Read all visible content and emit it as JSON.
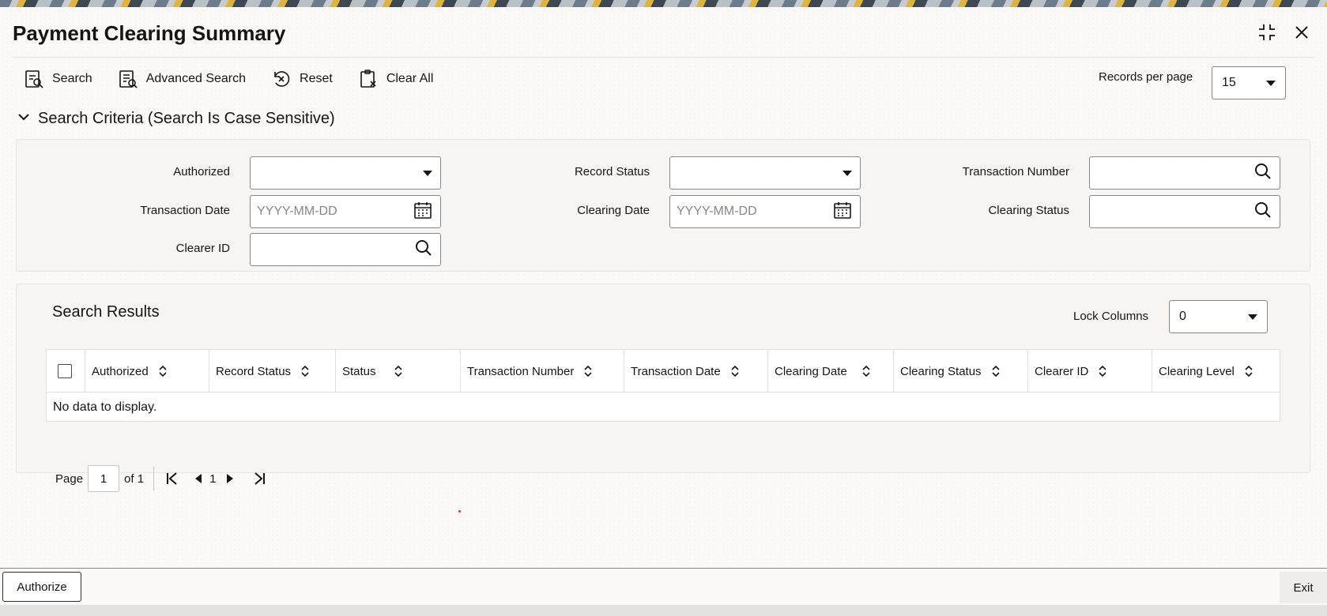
{
  "window": {
    "title": "Payment Clearing Summary",
    "icons": [
      "collapse-icon",
      "close-icon"
    ]
  },
  "toolbar": {
    "search_label": "Search",
    "advanced_search_label": "Advanced Search",
    "reset_label": "Reset",
    "clear_all_label": "Clear All",
    "records_per_page_label": "Records per page",
    "records_per_page_value": "15"
  },
  "criteria": {
    "heading": "Search Criteria (Search Is Case Sensitive)",
    "fields": {
      "authorized_label": "Authorized",
      "authorized_value": "",
      "record_status_label": "Record Status",
      "record_status_value": "",
      "transaction_number_label": "Transaction Number",
      "transaction_date_label": "Transaction Date",
      "transaction_date_placeholder": "YYYY-MM-DD",
      "clearing_date_label": "Clearing Date",
      "clearing_date_placeholder": "YYYY-MM-DD",
      "clearing_status_label": "Clearing Status",
      "clearer_id_label": "Clearer ID"
    }
  },
  "results": {
    "title": "Search Results",
    "lock_columns_label": "Lock Columns",
    "lock_columns_value": "0",
    "columns": [
      "Authorized",
      "Record Status",
      "Status",
      "Transaction Number",
      "Transaction Date",
      "Clearing Date",
      "Clearing Status",
      "Clearer ID",
      "Clearing Level"
    ],
    "empty_message": "No data to display."
  },
  "pager": {
    "page_label": "Page",
    "page_value": "1",
    "of_label": "of 1",
    "current_page": "1"
  },
  "footer": {
    "authorize_label": "Authorize",
    "exit_label": "Exit"
  }
}
